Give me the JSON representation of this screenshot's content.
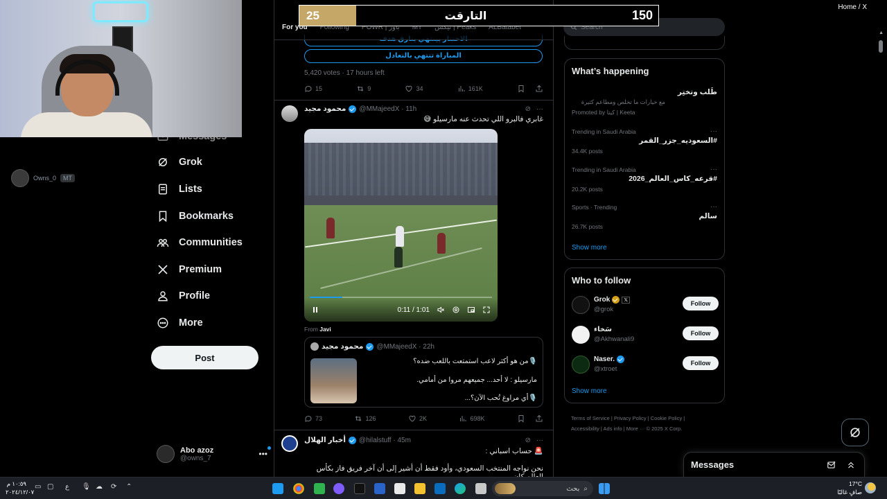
{
  "overlay": {
    "score_left": "25",
    "score_title": "التارقت",
    "score_right": "150"
  },
  "viewer": {
    "name": "Owns_0",
    "tag": "MT"
  },
  "nav": {
    "items": [
      {
        "label": "Messages",
        "icon": "mail-icon"
      },
      {
        "label": "Grok",
        "icon": "grok-icon"
      },
      {
        "label": "Lists",
        "icon": "lists-icon"
      },
      {
        "label": "Bookmarks",
        "icon": "bookmark-icon"
      },
      {
        "label": "Communities",
        "icon": "communities-icon"
      },
      {
        "label": "Premium",
        "icon": "x-logo-icon"
      },
      {
        "label": "Profile",
        "icon": "profile-icon"
      },
      {
        "label": "More",
        "icon": "more-circle-icon"
      }
    ],
    "post_label": "Post"
  },
  "account": {
    "name": "Abo azoz",
    "handle": "@owns_7",
    "more": "•••"
  },
  "feed": {
    "tabs": [
      "For you",
      "Following",
      "POWR | باور",
      "MT",
      "نيكس | Peaks",
      "ALBatabet"
    ],
    "poll": {
      "option_partial": "الاختتار بينتهي بتارق هدف",
      "option_2": "المباراة تنتهي بالتعادل",
      "votes": "5,420 votes · 17 hours left",
      "replies": "15",
      "reposts": "9",
      "likes": "34",
      "views": "161K"
    },
    "tweet1": {
      "name": "محمود مجيد",
      "handle": "@MMajeedX · 11h",
      "text": "غابري فالبرو اللي تحدث عنه مارسيلو 😅",
      "video_time": "0:11 / 1:01",
      "video_progress": 0.18,
      "from_label": "From",
      "from_name": "Javi",
      "quote": {
        "name": "محمود مجيد",
        "handle": "@MMajeedX · 22h",
        "line1": "🎙️من هو أكثر لاعب استمتعت باللعب ضده؟",
        "line2": "مارسيلو : لا أحد... جميعهم مروا من أمامي.",
        "line3": "🎙️أي مراوغ تُحب الآن؟..."
      },
      "replies": "73",
      "reposts": "126",
      "likes": "2K",
      "views": "698K"
    },
    "tweet2": {
      "name": "أخبار الهلال",
      "handle": "@hilalstuff · 45m",
      "line1": "🚨 حساب اسباني :",
      "line2": "نحن نواجه المنتخب السعودي، وأود فقط أن أشير إلى أن آخر فريق فاز بكأس العالم كان"
    }
  },
  "search": {
    "placeholder": "Search"
  },
  "whats_happening": {
    "title": "What’s happening",
    "promo": {
      "title": "طَلب وتختِر",
      "subtitle": "مع خيارات ما تخلص ومطاعم كثيرة",
      "promoted": "Promoted by كيتا | Keeta"
    },
    "trends": [
      {
        "context": "Trending in Saudi Arabia",
        "title": "#السعوديه_جزر_القمر",
        "posts": "34.4K posts"
      },
      {
        "context": "Trending in Saudi Arabia",
        "title": "#قرعه_كاس_العالم_2026",
        "posts": "20.2K posts"
      },
      {
        "context": "Sports · Trending",
        "title": "سالم",
        "posts": "26.7K posts"
      }
    ],
    "show_more": "Show more"
  },
  "who_to_follow": {
    "title": "Who to follow",
    "users": [
      {
        "name": "Grok",
        "handle": "@grok",
        "badge": "gold",
        "follow": "Follow"
      },
      {
        "name": "سَخاء",
        "handle": "@Akhwanali9",
        "badge": "",
        "follow": "Follow"
      },
      {
        "name": "Naser.",
        "handle": "@xtroet",
        "badge": "blue",
        "follow": "Follow"
      }
    ],
    "show_more": "Show more"
  },
  "footer": {
    "line1": "Terms of Service  |  Privacy Policy  |  Cookie Policy  |",
    "line2": "Accessibility  |  Ads info  |  More ···  © 2025 X Corp."
  },
  "messages_drawer": {
    "title": "Messages"
  },
  "breadcrumb": "Home / X",
  "taskbar": {
    "clock_time": "١٠:٥٩ م",
    "clock_date": "٢٠٢٤/١٢/٠٧",
    "search_label": "بحث",
    "weather_temp": "17°C",
    "weather_desc": "صافٍ غالبًا",
    "lang": "ع"
  },
  "colors": {
    "accent": "#1d9bf0",
    "score_gold": "#c5a868"
  }
}
